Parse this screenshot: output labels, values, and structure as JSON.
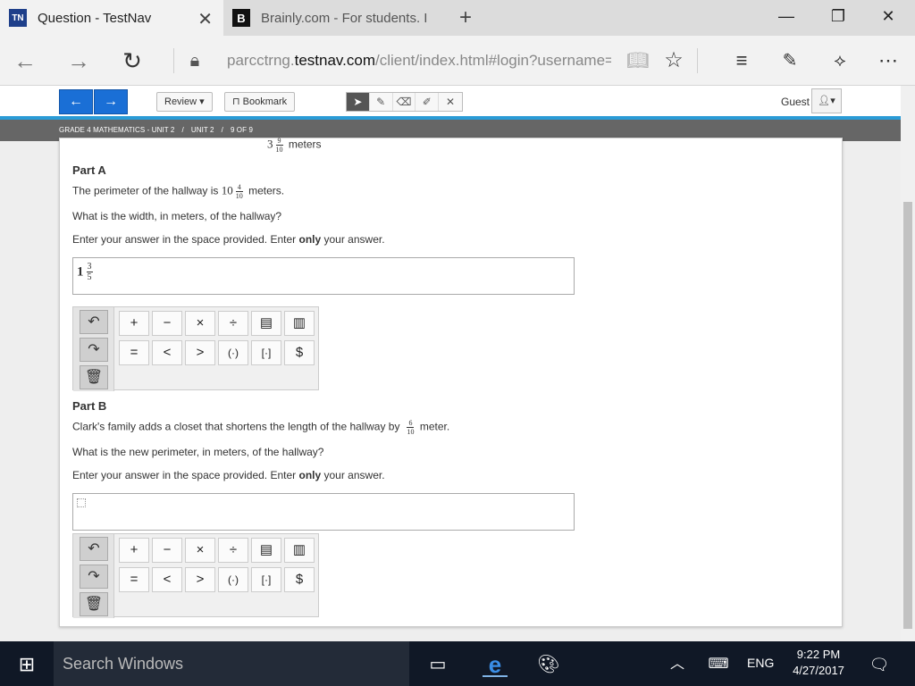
{
  "browser": {
    "tabs": [
      {
        "favicon": "TN",
        "title": "Question - TestNav"
      },
      {
        "favicon": "B",
        "title": "Brainly.com - For students. I"
      }
    ],
    "url_prefix": "parcctrng.",
    "url_domain": "testnav.com",
    "url_rest": "/client/index.html#login?username=1"
  },
  "toolbar": {
    "review_label": "Review",
    "bookmark_label": "Bookmark",
    "guest_label": "Guest"
  },
  "breadcrumb": [
    "GRADE 4 MATHEMATICS - UNIT 2",
    "/",
    "UNIT 2",
    "/",
    "9 OF 9"
  ],
  "question": {
    "top_whole": "3",
    "top_num": "9",
    "top_den": "10",
    "top_unit": "meters",
    "partA": {
      "heading": "Part A",
      "line1_pre": "The perimeter of the hallway is",
      "line1_whole": "10",
      "line1_num": "4",
      "line1_den": "10",
      "line1_post": "meters.",
      "line2": "What is the width, in meters, of the hallway?",
      "line3_pre": "Enter your answer in the space provided. Enter",
      "line3_bold": "only",
      "line3_post": "your answer.",
      "answer_whole": "1",
      "answer_num": "3",
      "answer_den": "5"
    },
    "partB": {
      "heading": "Part B",
      "line1_pre": "Clark's family adds a closet that shortens the length of the hallway by",
      "line1_num": "6",
      "line1_den": "10",
      "line1_post": "meter.",
      "line2": "What is the new perimeter, in meters, of the hallway?",
      "line3_pre": "Enter your answer in the space provided. Enter",
      "line3_bold": "only",
      "line3_post": "your answer."
    }
  },
  "keypad": {
    "row1": [
      "+",
      "−",
      "×",
      "÷",
      "▤",
      "▥"
    ],
    "row2": [
      "=",
      "<",
      ">",
      "(·)",
      "[·]",
      "$"
    ]
  },
  "taskbar": {
    "search_placeholder": "Search Windows",
    "lang": "ENG",
    "time": "9:22 PM",
    "date": "4/27/2017"
  }
}
